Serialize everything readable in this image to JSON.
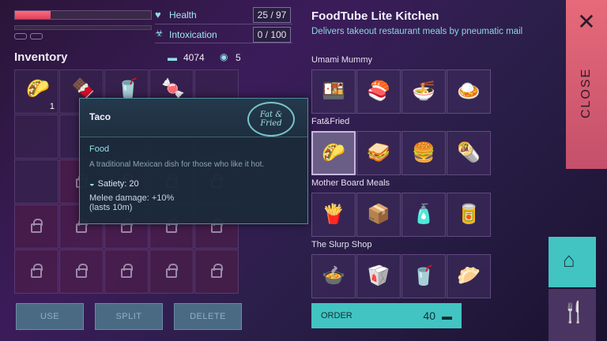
{
  "stats": {
    "health_label": "Health",
    "health_value": "25 / 97",
    "health_fraction": 0.26,
    "intox_label": "Intoxication",
    "intox_value": "0 / 100"
  },
  "inventory": {
    "title": "Inventory",
    "money": "4074",
    "tokens": "5",
    "items": [
      {
        "icon": "taco-icon",
        "glyph": "🌮",
        "qty": "1"
      },
      {
        "icon": "candy-bar-icon",
        "glyph": "🍫",
        "qty": ""
      },
      {
        "icon": "soda-can-icon",
        "glyph": "🥤",
        "qty": ""
      },
      {
        "icon": "snack-bar-icon",
        "glyph": "🍬",
        "qty": ""
      }
    ],
    "buttons": {
      "use": "USE",
      "split": "SPLIT",
      "delete": "DELETE"
    }
  },
  "tooltip": {
    "name": "Taco",
    "logo_text": "Fat & Fried",
    "type": "Food",
    "description": "A traditional Mexican dish for those who like it hot.",
    "satiety": "Satiety: 20",
    "melee": "Melee damage: +10%",
    "melee_duration": "(lasts 10m)"
  },
  "kitchen": {
    "title": "FoodTube Lite Kitchen",
    "subtitle": "Delivers takeout restaurant meals by pneumatic mail",
    "restaurants": [
      {
        "name": "Umami Mummy",
        "items": [
          "tofu-icon",
          "sushi-icon",
          "soup-icon",
          "plate-icon"
        ],
        "glyphs": [
          "🍱",
          "🍣",
          "🍜",
          "🍛"
        ]
      },
      {
        "name": "Fat&Fried",
        "items": [
          "taco-icon",
          "sandwich-icon",
          "burger-icon",
          "wrap-icon"
        ],
        "glyphs": [
          "🌮",
          "🥪",
          "🍔",
          "🌯"
        ]
      },
      {
        "name": "Mother Board Meals",
        "items": [
          "chips-icon",
          "cereal-box-icon",
          "bottle-icon",
          "pouch-icon"
        ],
        "glyphs": [
          "🍟",
          "📦",
          "🧴",
          "🥫"
        ]
      },
      {
        "name": "The Slurp Shop",
        "items": [
          "bowl-icon",
          "noodle-box-icon",
          "cup-icon",
          "dumpling-icon"
        ],
        "glyphs": [
          "🍲",
          "🥡",
          "🥤",
          "🥟"
        ]
      }
    ],
    "order_label": "ORDER",
    "order_price": "40"
  },
  "close_label": "CLOSE"
}
